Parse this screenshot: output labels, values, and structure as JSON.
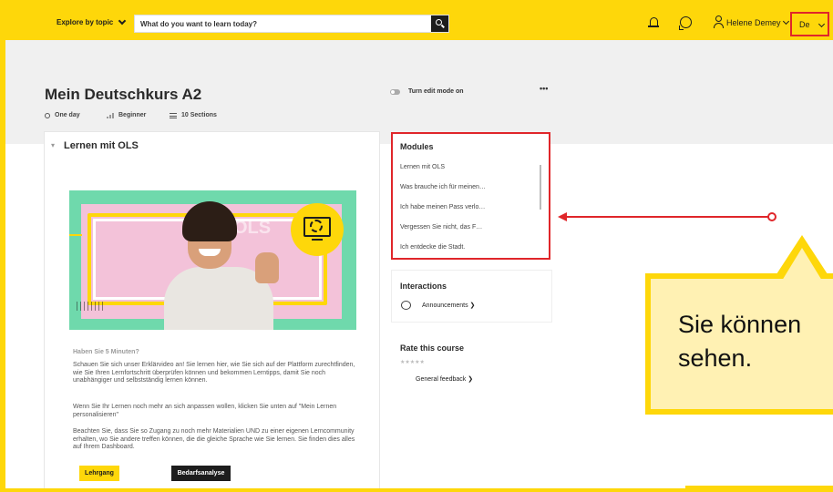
{
  "header": {
    "explore_label": "Explore by topic",
    "search_placeholder": "What do you want to learn today?",
    "user_name": "Helene Demey",
    "language": "De"
  },
  "course": {
    "title": "Mein Deutschkurs A2",
    "duration": "One day",
    "level": "Beginner",
    "sections": "10 Sections",
    "edit_mode_label": "Turn edit mode on",
    "more_label": "•••"
  },
  "section": {
    "title": "Lernen mit OLS",
    "hero_text": "OLS",
    "intro_heading": "Haben Sie 5 Minuten?",
    "paragraphs": [
      "Schauen Sie sich unser Erklärvideo an! Sie lernen hier, wie Sie sich auf der Plattform zurechtfinden, wie Sie Ihren Lernfortschritt überprüfen können und bekommen Lerntipps, damit Sie noch unabhängiger und selbstständig lernen können.",
      "Wenn Sie Ihr Lernen noch mehr an sich anpassen wollen, klicken Sie unten auf \"Mein Lernen personalisieren\"",
      "Beachten Sie, dass Sie so Zugang zu noch mehr Materialien UND zu einer eigenen Lerncommunity erhalten, wo Sie andere treffen können, die die gleiche Sprache wie Sie lernen. Sie finden dies alles auf Ihrem Dashboard."
    ],
    "btn_primary": "Lehrgang",
    "btn_secondary": "Bedarfsanalyse"
  },
  "modules": {
    "title": "Modules",
    "items": [
      "Lernen mit OLS",
      "Was brauche ich für meinen…",
      "Ich habe meinen Pass verlo…",
      "Vergessen Sie nicht, das F…",
      "Ich entdecke die Stadt."
    ]
  },
  "interactions": {
    "title": "Interactions",
    "announcements": "Announcements ❯"
  },
  "rating": {
    "title": "Rate this course",
    "stars": "★★★★★",
    "feedback": "General feedback ❯"
  },
  "callout": {
    "line1": "Sie können",
    "line2": "sehen."
  },
  "colors": {
    "brand_yellow": "#fed70a",
    "highlight_red": "#e0262a",
    "header_grey": "#f0f0f0"
  }
}
